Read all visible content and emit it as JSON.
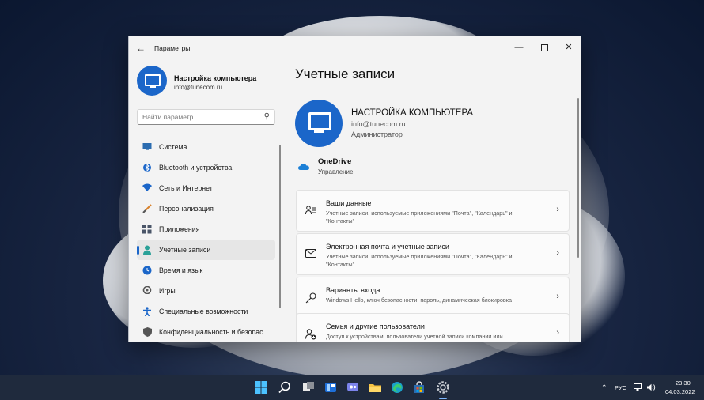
{
  "window": {
    "title": "Параметры",
    "back_icon": "back-arrow-icon",
    "min_label": "—",
    "close_label": "✕"
  },
  "sidebar": {
    "user": {
      "name": "Настройка компьютера",
      "email": "info@tunecom.ru"
    },
    "search": {
      "placeholder": "Найти параметр",
      "icon": "search-icon"
    },
    "items": [
      {
        "label": "Система",
        "icon": "monitor-icon",
        "color": "#2b6cb0"
      },
      {
        "label": "Bluetooth и устройства",
        "icon": "bluetooth-icon",
        "color": "#1b66c9"
      },
      {
        "label": "Сеть и Интернет",
        "icon": "wifi-icon",
        "color": "#1b66c9"
      },
      {
        "label": "Персонализация",
        "icon": "brush-icon",
        "color": "#d9822b"
      },
      {
        "label": "Приложения",
        "icon": "apps-icon",
        "color": "#4a5568"
      },
      {
        "label": "Учетные записи",
        "icon": "person-icon",
        "color": "#2aa198",
        "active": true
      },
      {
        "label": "Время и язык",
        "icon": "globe-clock-icon",
        "color": "#1b66c9"
      },
      {
        "label": "Игры",
        "icon": "gamepad-icon",
        "color": "#555555"
      },
      {
        "label": "Специальные возможности",
        "icon": "accessibility-icon",
        "color": "#1b66c9"
      },
      {
        "label": "Конфиденциальность и безопас",
        "icon": "shield-icon",
        "color": "#555555"
      }
    ]
  },
  "main": {
    "title": "Учетные записи",
    "user": {
      "name": "НАСТРОЙКА КОМПЬЮТЕРА",
      "email": "info@tunecom.ru",
      "role": "Администратор"
    },
    "onedrive": {
      "title": "OneDrive",
      "subtitle": "Управление"
    },
    "cards": [
      {
        "title": "Ваши данные",
        "subtitle": "Учетные записи, используемые приложениями \"Почта\", \"Календарь\" и \"Контакты\"",
        "icon": "person-list-icon"
      },
      {
        "title": "Электронная почта и учетные записи",
        "subtitle": "Учетные записи, используемые приложениями \"Почта\", \"Календарь\" и \"Контакты\"",
        "icon": "mail-icon"
      },
      {
        "title": "Варианты входа",
        "subtitle": "Windows Hello, ключ безопасности, пароль, динамическая блокировка",
        "icon": "key-icon"
      },
      {
        "title": "Семья и другие пользователи",
        "subtitle": "Доступ к устройствам, пользователи учетной записи компании или",
        "icon": "people-add-icon"
      }
    ]
  },
  "taskbar": {
    "lang": "РУС",
    "time": "23:30",
    "date": "04.03.2022"
  }
}
